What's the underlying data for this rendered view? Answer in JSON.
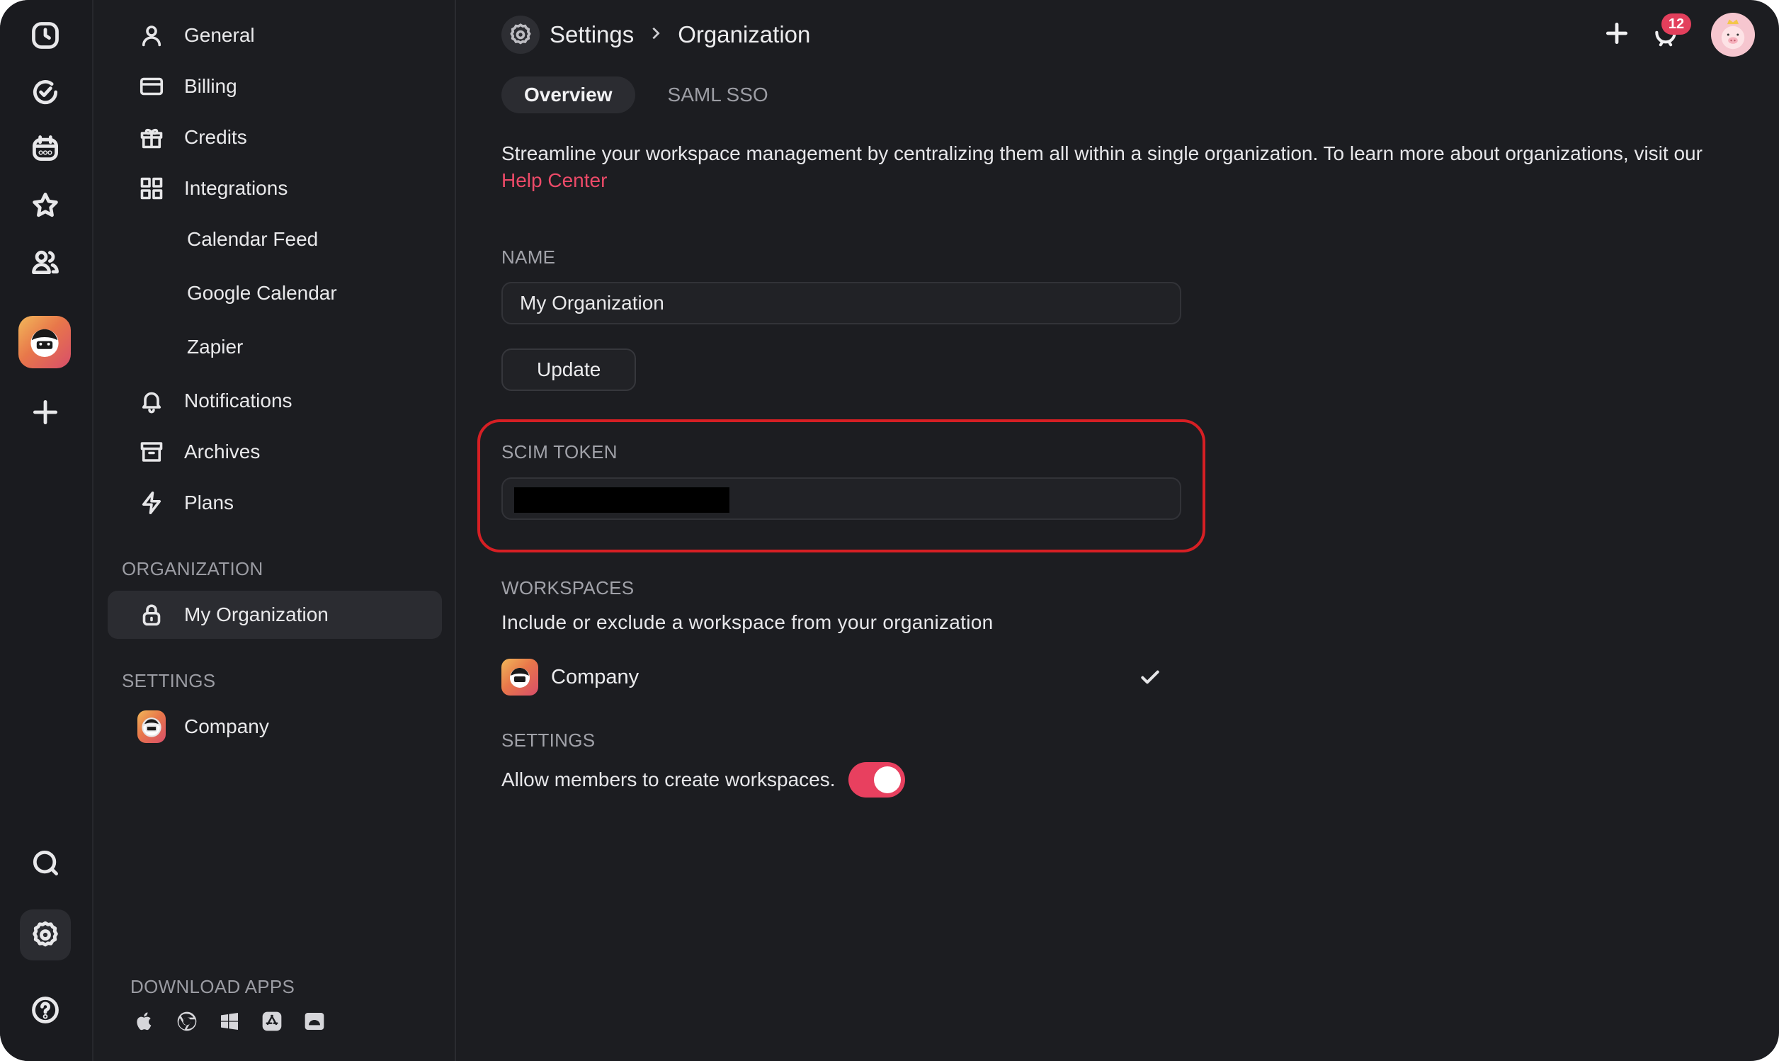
{
  "sidebar": {
    "items": [
      {
        "label": "General"
      },
      {
        "label": "Billing"
      },
      {
        "label": "Credits"
      },
      {
        "label": "Integrations"
      },
      {
        "label": "Calendar Feed"
      },
      {
        "label": "Google Calendar"
      },
      {
        "label": "Zapier"
      },
      {
        "label": "Notifications"
      },
      {
        "label": "Archives"
      },
      {
        "label": "Plans"
      }
    ],
    "org_heading": "ORGANIZATION",
    "org_item": "My Organization",
    "settings_heading": "SETTINGS",
    "settings_item": "Company",
    "download_heading": "DOWNLOAD APPS",
    "download_icons": [
      "apple-icon",
      "chrome-icon",
      "windows-icon",
      "app-store-icon",
      "android-icon"
    ]
  },
  "header": {
    "crumb_1": "Settings",
    "crumb_2": "Organization",
    "notification_count": "12"
  },
  "tabs": [
    {
      "label": "Overview",
      "active": true
    },
    {
      "label": "SAML SSO",
      "active": false
    }
  ],
  "intro": {
    "text": "Streamline your workspace management by centralizing them all within a single organization. To learn more about organizations, visit our ",
    "link": "Help Center"
  },
  "name_section": {
    "label": "NAME",
    "value": "My Organization",
    "button": "Update"
  },
  "scim_section": {
    "label": "SCIM TOKEN"
  },
  "workspaces_section": {
    "label": "WORKSPACES",
    "description": "Include or exclude a workspace from your organization",
    "workspace_name": "Company",
    "included": true
  },
  "settings_section": {
    "label": "SETTINGS",
    "toggle_label": "Allow members to create workspaces.",
    "toggle_on": true
  },
  "colors": {
    "background": "#1c1d21",
    "accent": "#e8405f",
    "highlight_outline": "#d61f24"
  }
}
